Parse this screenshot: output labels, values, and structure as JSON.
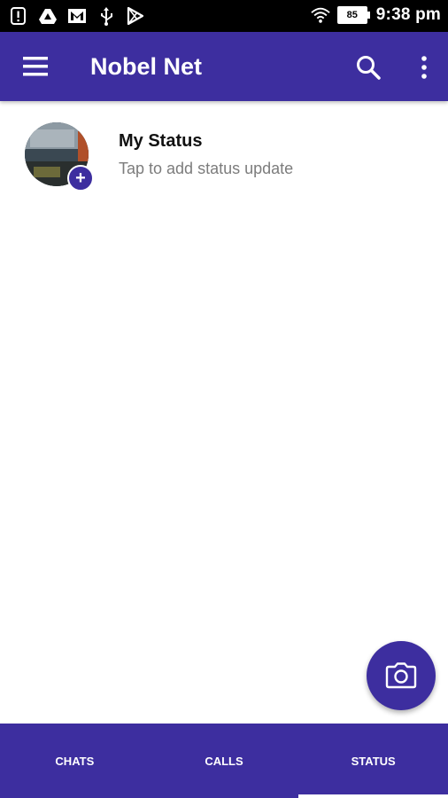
{
  "status_bar": {
    "left_icons": [
      "alert-icon",
      "drive-icon",
      "gmail-icon",
      "usb-icon",
      "play-store-icon"
    ],
    "right_icons": [
      "wifi-icon",
      "battery-icon"
    ],
    "battery_level": "85",
    "time": "9:38 pm"
  },
  "app_bar": {
    "title": "Nobel Net",
    "icons": [
      "menu-icon",
      "search-icon",
      "more-vert-icon"
    ]
  },
  "my_status": {
    "title": "My Status",
    "subtitle": "Tap to add status update",
    "badge": "+"
  },
  "fab": {
    "icon": "camera-icon"
  },
  "tabs": [
    {
      "label": "CHATS",
      "selected": false
    },
    {
      "label": "CALLS",
      "selected": false
    },
    {
      "label": "STATUS",
      "selected": true
    }
  ],
  "colors": {
    "primary": "#3d2e9f",
    "status_bar": "#000000",
    "subtitle_text": "#7c7c7c"
  }
}
